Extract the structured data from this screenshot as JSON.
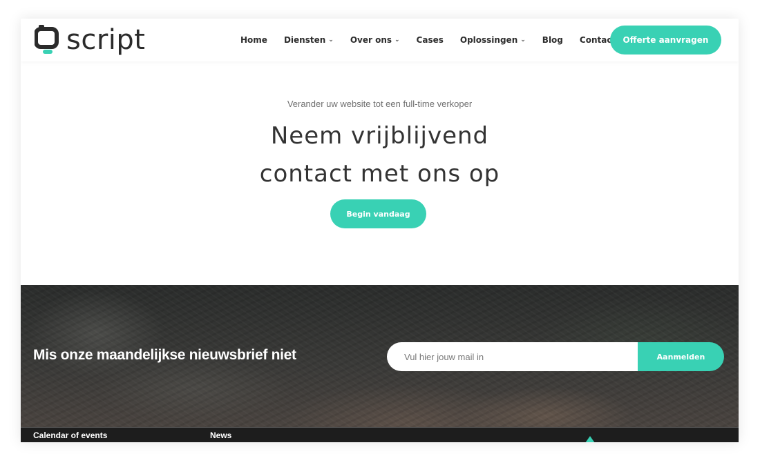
{
  "brand": {
    "logo_text": "script",
    "accent_color": "#39d1b4"
  },
  "nav": {
    "items": [
      {
        "label": "Home",
        "has_dropdown": false
      },
      {
        "label": "Diensten",
        "has_dropdown": true
      },
      {
        "label": "Over ons",
        "has_dropdown": true
      },
      {
        "label": "Cases",
        "has_dropdown": false
      },
      {
        "label": "Oplossingen",
        "has_dropdown": true
      },
      {
        "label": "Blog",
        "has_dropdown": false
      },
      {
        "label": "Contact",
        "has_dropdown": false
      }
    ],
    "dropdown_icon": "chevron-down-icon",
    "cta_label": "Offerte aanvragen"
  },
  "hero": {
    "subtitle": "Verander uw website tot een full-time verkoper",
    "title_line1": "Neem vrijblijvend",
    "title_line2": "contact met ons op",
    "button_label": "Begin vandaag"
  },
  "newsletter": {
    "title": "Mis onze maandelijkse nieuwsbrief niet",
    "input_placeholder": "Vul hier jouw mail in",
    "input_value": "",
    "button_label": "Aanmelden"
  },
  "footer": {
    "col1_title": "Calendar of events",
    "col2_title": "News"
  }
}
